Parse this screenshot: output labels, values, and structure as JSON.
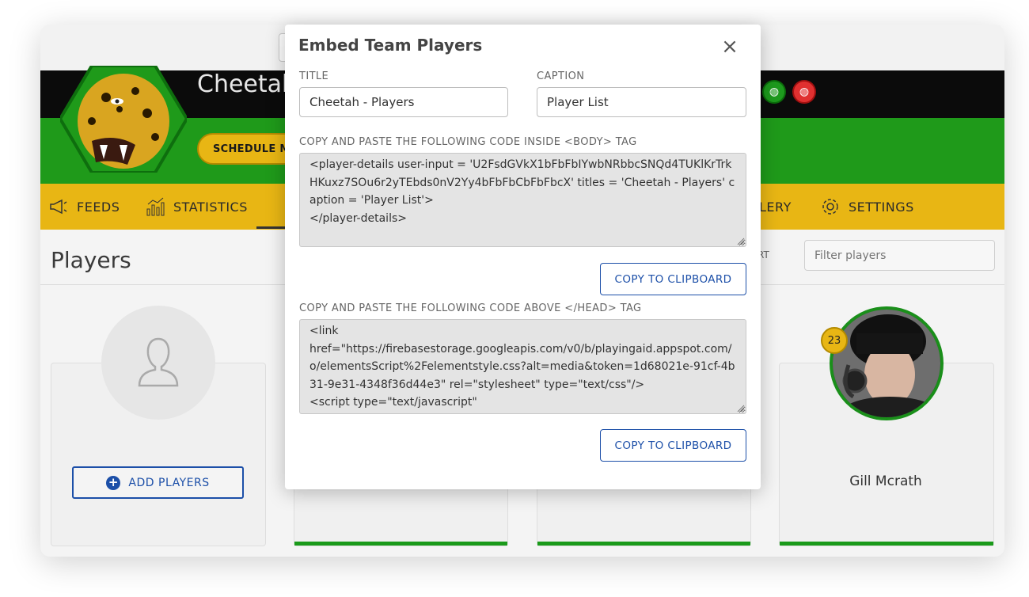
{
  "background": {
    "team_name": "Cheetah",
    "schedule_button": "SCHEDULE MA",
    "nav": {
      "feeds": "FEEDS",
      "statistics": "STATISTICS",
      "gallery": "LERY",
      "settings": "SETTINGS"
    },
    "page_title": "Players",
    "sort_label": "RT",
    "filter_placeholder": "Filter players",
    "add_players_label": "ADD PLAYERS",
    "player": {
      "name": "Gill Mcrath",
      "number": "23"
    },
    "colors": {
      "accent_yellow": "#e8b614",
      "team_green": "#1f9a1a",
      "primary_blue": "#1c4fa8"
    }
  },
  "modal": {
    "title": "Embed Team Players",
    "close_icon": "close-icon",
    "title_field": {
      "label": "TITLE",
      "value": "Cheetah - Players"
    },
    "caption_field": {
      "label": "CAPTION",
      "value": "Player List"
    },
    "body_code": {
      "label": "COPY AND PASTE THE FOLLOWING CODE INSIDE <BODY> TAG",
      "code": "<player-details user-input = 'U2FsdGVkX1bFbFbIYwbNRbbcSNQd4TUKlKrTrkHKuxz7SOu6r2yTEbds0nV2Yy4bFbFbCbFbFbcX' titles = 'Cheetah - Players' caption = 'Player List'>\n</player-details>",
      "copy_label": "COPY TO CLIPBOARD"
    },
    "head_code": {
      "label": "COPY AND PASTE THE FOLLOWING CODE ABOVE </HEAD> TAG",
      "code": "<link\nhref=\"https://firebasestorage.googleapis.com/v0/b/playingaid.appspot.com/o/elementsScript%2Felementstyle.css?alt=media&token=1d68021e-91cf-4b31-9e31-4348f36d44e3\" rel=\"stylesheet\" type=\"text/css\"/>\n<script type=\"text/javascript\"",
      "copy_label": "COPY TO CLIPBOARD"
    }
  }
}
